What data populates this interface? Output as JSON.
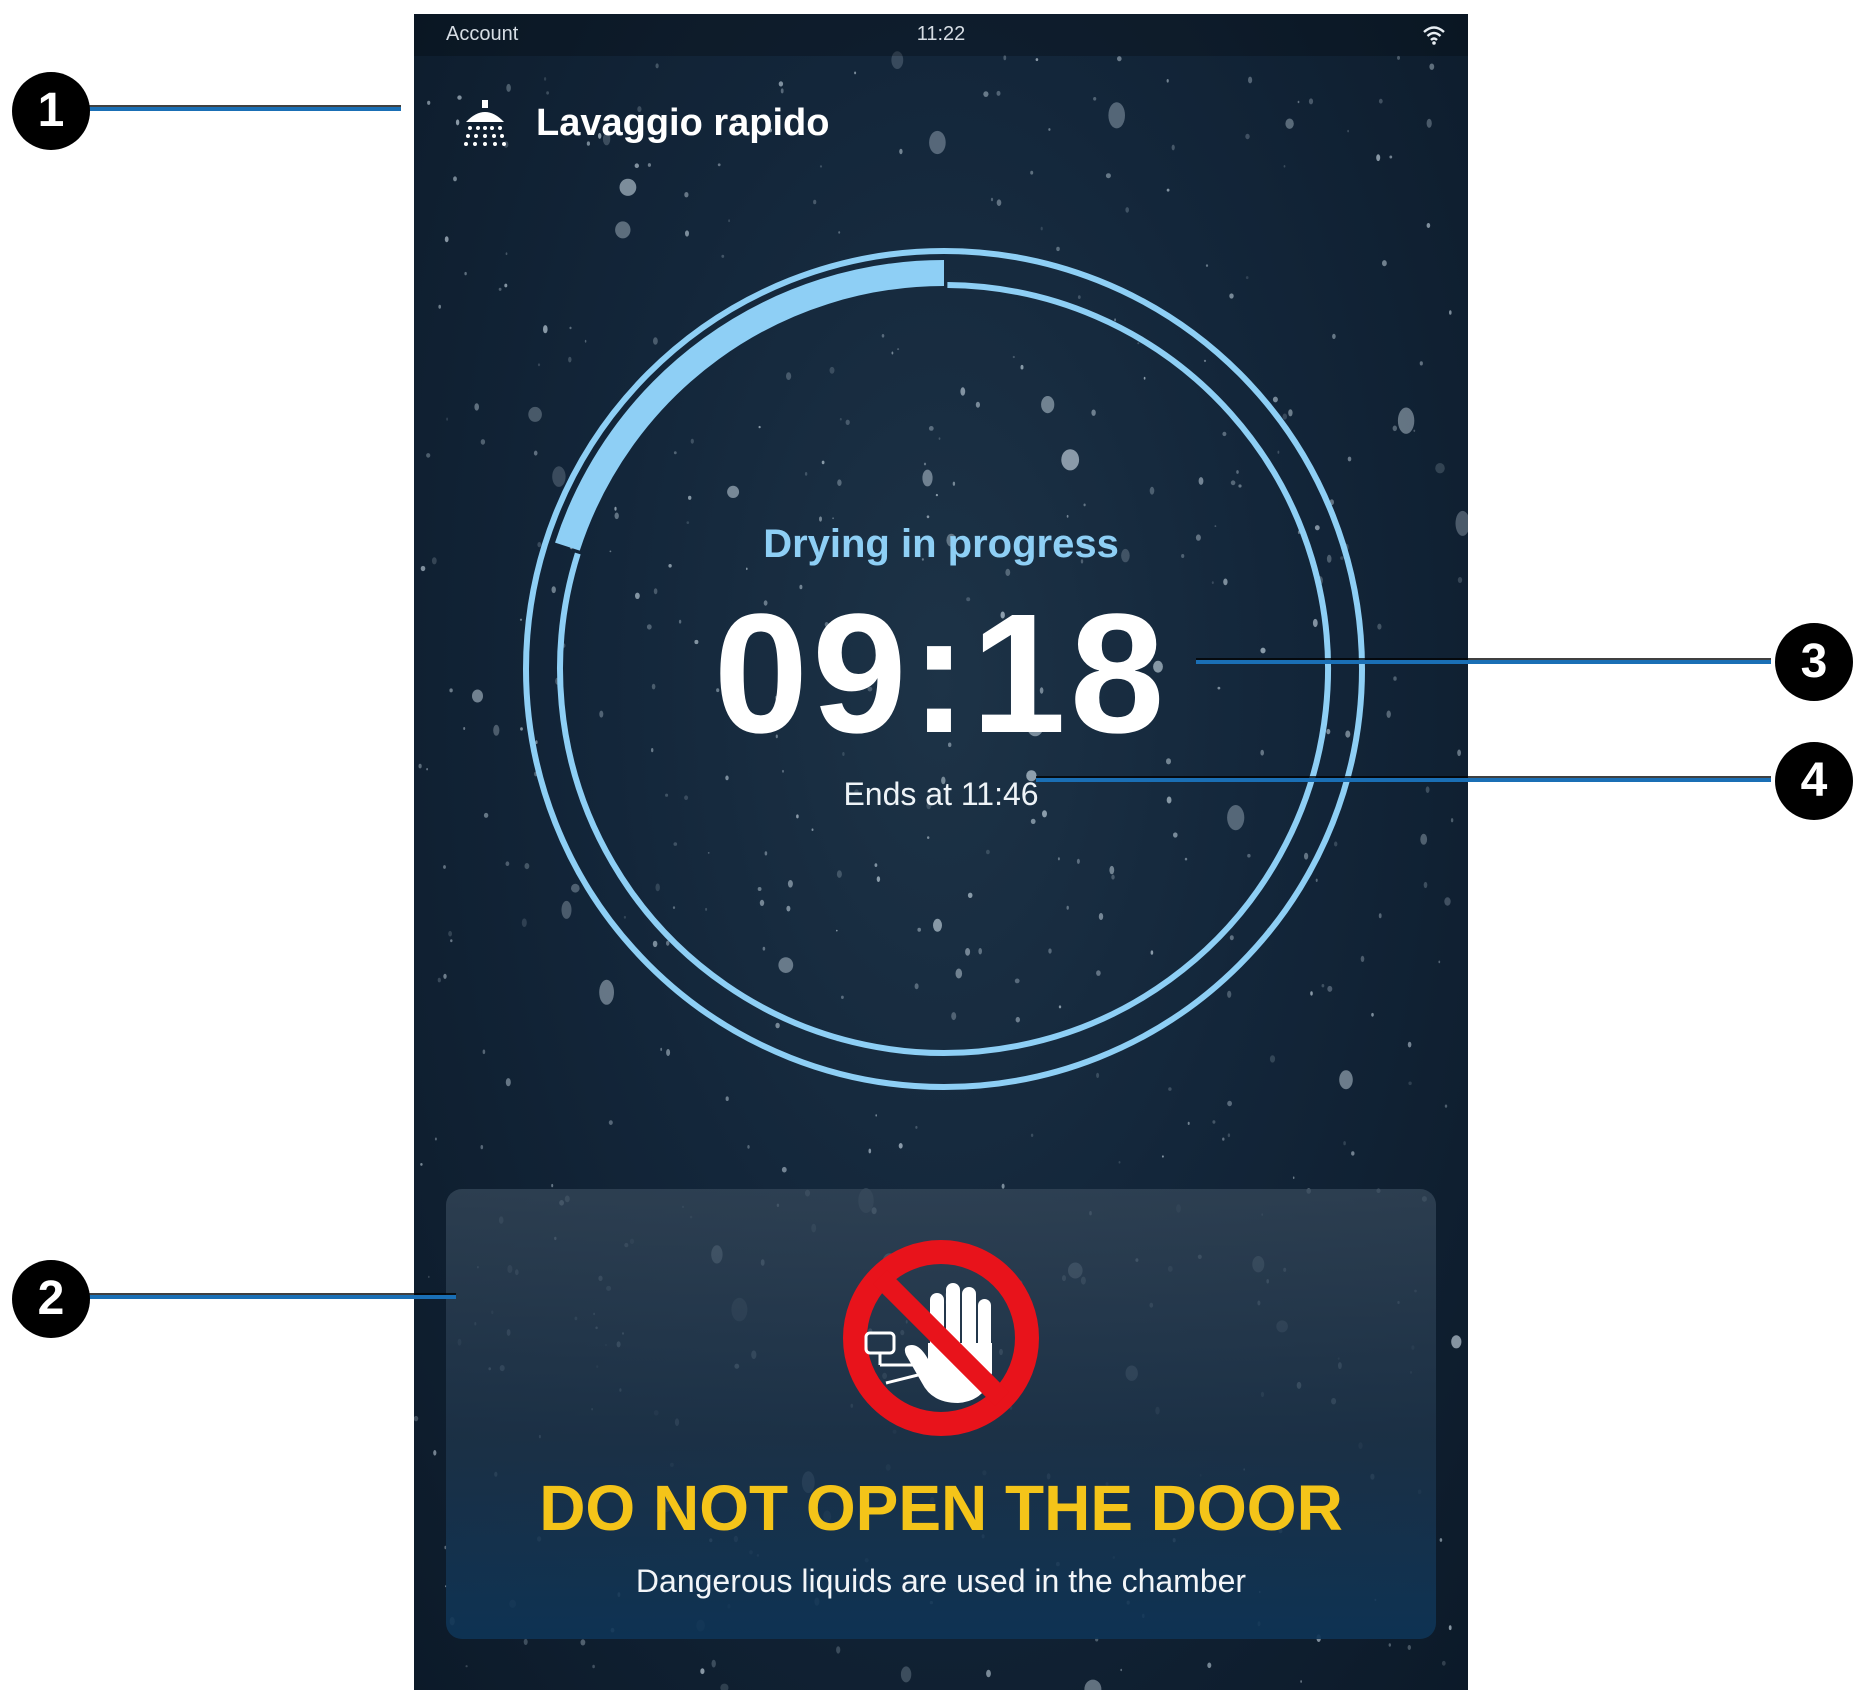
{
  "status_bar": {
    "left_label": "Account",
    "time": "11:22",
    "wifi_icon": "wifi-icon"
  },
  "header": {
    "icon": "shower-icon",
    "title": "Lavaggio rapido"
  },
  "timer": {
    "status": "Drying in progress",
    "remaining": "09:18",
    "end_label": "Ends at 11:46",
    "phase_progress_fraction": 0.2,
    "ring_color": "#8ecff5"
  },
  "warning": {
    "icon": "no-hand-prohibition-icon",
    "title": "DO NOT OPEN THE DOOR",
    "subtitle": "Dangerous liquids are used in the chamber",
    "title_color": "#f4c419",
    "sign_color": "#e8131b"
  },
  "callouts": [
    {
      "number": "1"
    },
    {
      "number": "2"
    },
    {
      "number": "3"
    },
    {
      "number": "4"
    }
  ]
}
